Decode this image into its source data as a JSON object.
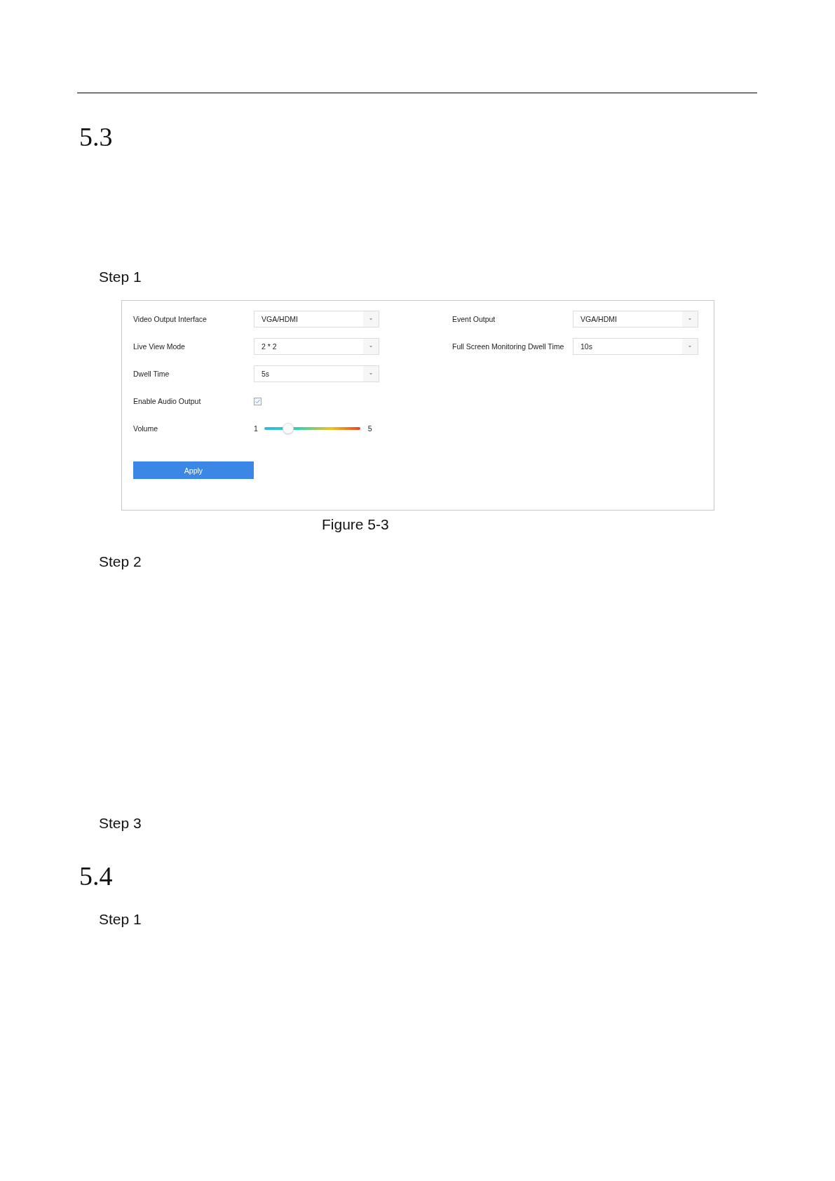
{
  "blocks": [
    {
      "kind": "heading",
      "text": "5.3"
    },
    {
      "kind": "step",
      "text": "Step 1"
    },
    {
      "kind": "figure",
      "panel": {
        "left_fields": [
          {
            "kind": "dropdown",
            "label": "Video Output Interface",
            "value": "VGA/HDMI"
          },
          {
            "kind": "dropdown",
            "label": "Live View Mode",
            "value": "2 * 2"
          },
          {
            "kind": "dropdown",
            "label": "Dwell Time",
            "value": "5s"
          },
          {
            "kind": "checkbox",
            "label": "Enable Audio Output",
            "checked": true
          },
          {
            "kind": "slider",
            "label": "Volume",
            "min": "1",
            "max": "5",
            "level": 0.25
          }
        ],
        "right_fields": [
          {
            "kind": "dropdown",
            "label": "Event Output",
            "value": "VGA/HDMI"
          },
          {
            "kind": "dropdown",
            "label": "Full Screen Monitoring Dwell Time",
            "value": "10s"
          }
        ],
        "apply_button": "Apply"
      }
    },
    {
      "kind": "caption",
      "text": "Figure 5-3"
    },
    {
      "kind": "step",
      "text": "Step 2"
    },
    {
      "kind": "step",
      "text": "Step 3"
    },
    {
      "kind": "heading",
      "text": "5.4"
    },
    {
      "kind": "step",
      "text": "Step 1"
    }
  ]
}
